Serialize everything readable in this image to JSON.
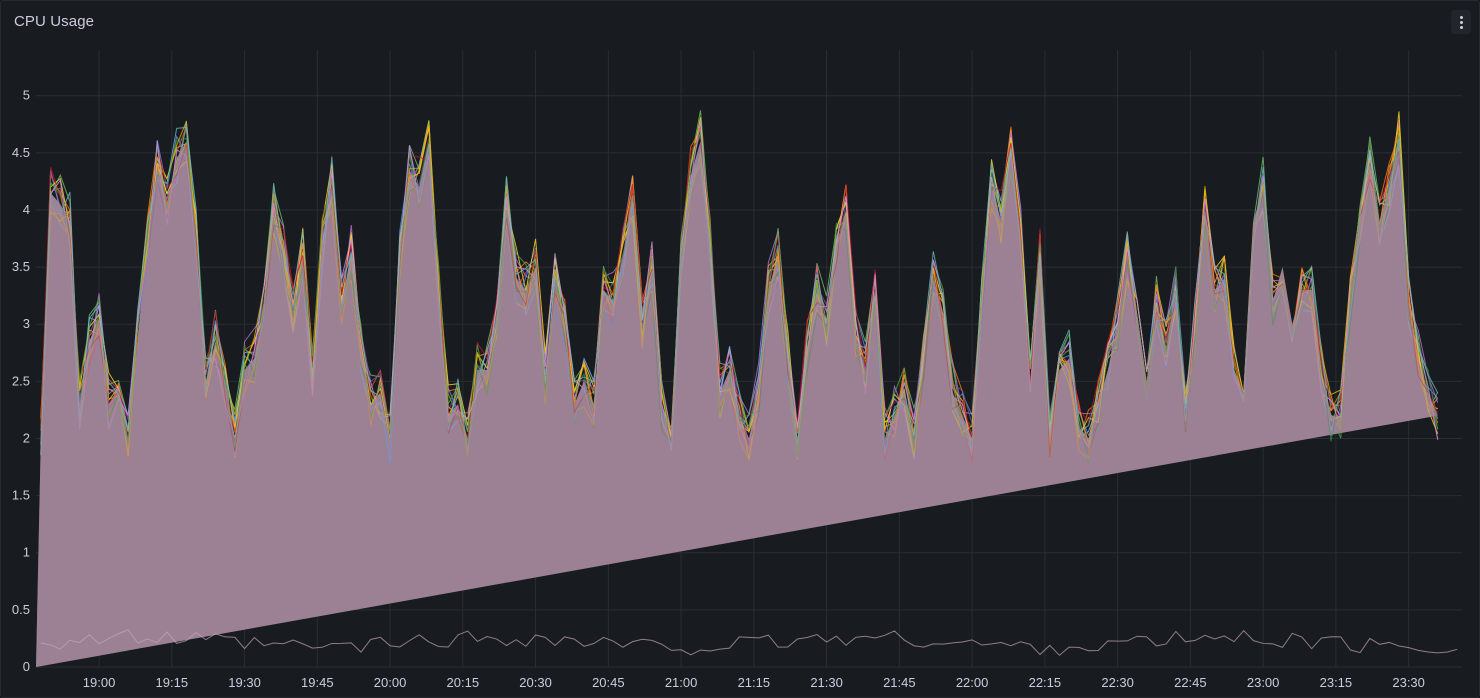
{
  "panel": {
    "title": "CPU Usage",
    "menu_icon": "vertical-dots-icon"
  },
  "colors": {
    "background": "#181b1f",
    "grid": "#2a2d33",
    "fill": "#9b8193",
    "series_palette": [
      "#73bf69",
      "#f2cc0c",
      "#8ab8ff",
      "#ff780a",
      "#f2495c",
      "#5794f2",
      "#b877d9",
      "#705da0",
      "#37872d",
      "#fade2a",
      "#ff9830",
      "#e0b400",
      "#c4162a",
      "#56a64b",
      "#ca95e5",
      "#6fb7c5"
    ]
  },
  "chart_data": {
    "type": "area",
    "title": "CPU Usage",
    "xlabel": "",
    "ylabel": "",
    "ylim": [
      0,
      5.4
    ],
    "grid": true,
    "legend": "none",
    "y_ticks": [
      "0",
      "0.5",
      "1",
      "1.5",
      "2",
      "2.5",
      "3",
      "3.5",
      "4",
      "4.5",
      "5"
    ],
    "x_ticks": [
      "19:00",
      "19:15",
      "19:30",
      "19:45",
      "20:00",
      "20:15",
      "20:30",
      "20:45",
      "21:00",
      "21:15",
      "21:30",
      "21:45",
      "22:00",
      "22:15",
      "22:30",
      "22:45",
      "23:00",
      "23:15",
      "23:30"
    ],
    "x_range": [
      "18:47",
      "23:41"
    ],
    "series_count": 16,
    "x": [
      "18:48",
      "18:50",
      "18:52",
      "18:54",
      "18:56",
      "18:58",
      "19:00",
      "19:02",
      "19:04",
      "19:06",
      "19:08",
      "19:10",
      "19:12",
      "19:14",
      "19:16",
      "19:18",
      "19:20",
      "19:22",
      "19:24",
      "19:26",
      "19:28",
      "19:30",
      "19:32",
      "19:34",
      "19:36",
      "19:38",
      "19:40",
      "19:42",
      "19:44",
      "19:46",
      "19:48",
      "19:50",
      "19:52",
      "19:54",
      "19:56",
      "19:58",
      "20:00",
      "20:02",
      "20:04",
      "20:06",
      "20:08",
      "20:10",
      "20:12",
      "20:14",
      "20:16",
      "20:18",
      "20:20",
      "20:22",
      "20:24",
      "20:26",
      "20:28",
      "20:30",
      "20:32",
      "20:34",
      "20:36",
      "20:38",
      "20:40",
      "20:42",
      "20:44",
      "20:46",
      "20:48",
      "20:50",
      "20:52",
      "20:54",
      "20:56",
      "20:58",
      "21:00",
      "21:02",
      "21:04",
      "21:06",
      "21:08",
      "21:10",
      "21:12",
      "21:14",
      "21:16",
      "21:18",
      "21:20",
      "21:22",
      "21:24",
      "21:26",
      "21:28",
      "21:30",
      "21:32",
      "21:34",
      "21:36",
      "21:38",
      "21:40",
      "21:42",
      "21:44",
      "21:46",
      "21:48",
      "21:50",
      "21:52",
      "21:54",
      "21:56",
      "21:58",
      "22:00",
      "22:02",
      "22:04",
      "22:06",
      "22:08",
      "22:10",
      "22:12",
      "22:14",
      "22:16",
      "22:18",
      "22:20",
      "22:22",
      "22:24",
      "22:26",
      "22:28",
      "22:30",
      "22:32",
      "22:34",
      "22:36",
      "22:38",
      "22:40",
      "22:42",
      "22:44",
      "22:46",
      "22:48",
      "22:50",
      "22:52",
      "22:54",
      "22:56",
      "22:58",
      "23:00",
      "23:02",
      "23:04",
      "23:06",
      "23:08",
      "23:10",
      "23:12",
      "23:14",
      "23:16",
      "23:18",
      "23:20",
      "23:22",
      "23:24",
      "23:26",
      "23:28",
      "23:30",
      "23:32",
      "23:34",
      "23:36",
      "23:38",
      "23:40"
    ],
    "values": [
      2.0,
      4.15,
      4.05,
      3.9,
      2.3,
      2.85,
      3.05,
      2.3,
      2.45,
      2.0,
      2.9,
      3.7,
      4.4,
      4.05,
      4.45,
      4.6,
      3.8,
      2.5,
      2.85,
      2.5,
      2.0,
      2.6,
      2.7,
      3.2,
      4.0,
      3.6,
      3.1,
      3.6,
      2.5,
      3.7,
      4.2,
      3.2,
      3.6,
      2.8,
      2.3,
      2.4,
      2.0,
      3.6,
      4.35,
      4.2,
      4.6,
      3.3,
      2.2,
      2.3,
      2.0,
      2.6,
      2.6,
      3.1,
      4.1,
      3.4,
      3.3,
      3.5,
      2.5,
      3.4,
      3.0,
      2.3,
      2.5,
      2.3,
      3.3,
      3.2,
      3.6,
      4.1,
      3.0,
      3.5,
      2.3,
      2.0,
      3.6,
      4.3,
      4.6,
      3.7,
      2.4,
      2.6,
      2.2,
      2.0,
      2.4,
      3.3,
      3.6,
      2.7,
      2.0,
      2.8,
      3.3,
      3.0,
      3.7,
      4.0,
      2.9,
      2.6,
      3.3,
      2.0,
      2.2,
      2.4,
      2.0,
      2.7,
      3.4,
      3.1,
      2.4,
      2.2,
      2.0,
      3.2,
      4.2,
      3.9,
      4.5,
      3.8,
      2.5,
      3.6,
      2.0,
      2.6,
      2.7,
      2.1,
      2.0,
      2.3,
      2.6,
      3.0,
      3.6,
      3.1,
      2.5,
      3.2,
      2.8,
      3.3,
      2.2,
      3.0,
      4.0,
      3.3,
      3.4,
      2.6,
      2.4,
      3.9,
      4.2,
      3.2,
      3.5,
      3.0,
      3.3,
      3.3,
      2.6,
      2.2,
      2.2,
      3.2,
      3.9,
      4.4,
      3.9,
      4.2,
      4.6,
      3.2,
      2.7,
      2.4,
      2.2
    ]
  }
}
